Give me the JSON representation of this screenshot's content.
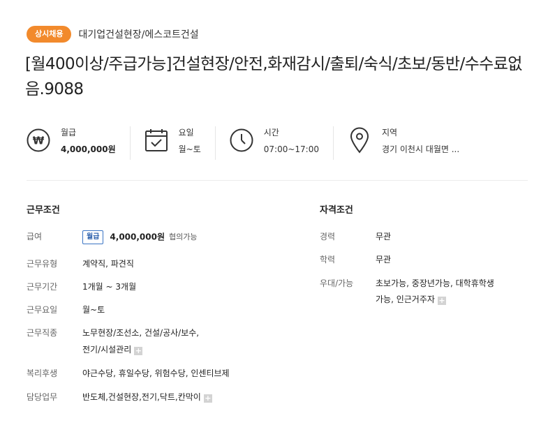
{
  "header": {
    "badge": "상시채용",
    "company": "대기업건설현장/에스코트건설",
    "title": "[월400이상/주급가능]건설현장/안전,화재감시/출퇴/숙식/초보/동반/수수료없음.9088"
  },
  "summary": [
    {
      "icon": "won-icon",
      "label": "월급",
      "value": "4,000,000원"
    },
    {
      "icon": "calendar-check-icon",
      "label": "요일",
      "value": "월~토"
    },
    {
      "icon": "clock-icon",
      "label": "시간",
      "value": "07:00~17:00"
    },
    {
      "icon": "location-pin-icon",
      "label": "지역",
      "value": "경기 이천시 대월면 ..."
    }
  ],
  "work_conditions": {
    "title": "근무조건",
    "pay": {
      "label": "급여",
      "tag": "월급",
      "amount": "4,000,000원",
      "note": "협의가능"
    },
    "rows": [
      {
        "label": "근무유형",
        "value": "계약직, 파견직"
      },
      {
        "label": "근무기간",
        "value": "1개월 ~ 3개월"
      },
      {
        "label": "근무요일",
        "value": "월~토"
      },
      {
        "label": "근무직종",
        "value": "노무현장/조선소, 건설/공사/보수,",
        "value2": "전기/시설관리"
      },
      {
        "label": "복리후생",
        "value": "야근수당, 휴일수당, 위험수당, 인센티브제"
      },
      {
        "label": "담당업무",
        "value": "반도체,건설현장,전기,닥트,칸막이"
      }
    ]
  },
  "qualifications": {
    "title": "자격조건",
    "rows": [
      {
        "label": "경력",
        "value": "무관"
      },
      {
        "label": "학력",
        "value": "무관"
      },
      {
        "label": "우대/가능",
        "value": "초보가능, 중장년가능, 대학휴학생",
        "value2": "가능, 인근거주자"
      }
    ]
  },
  "colors": {
    "badge": "#f28a2c",
    "pay_tag": "#3a74c4"
  }
}
